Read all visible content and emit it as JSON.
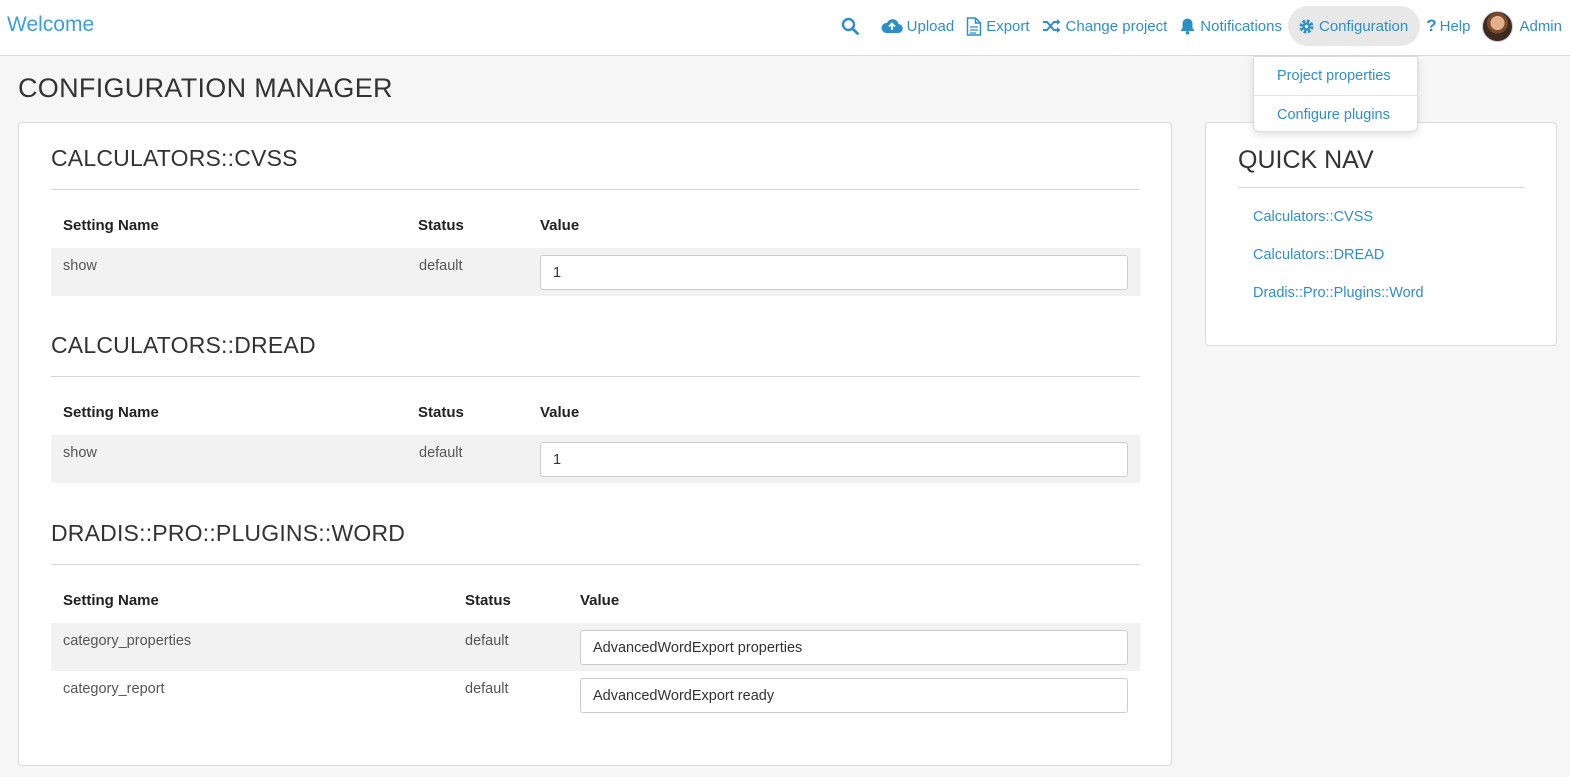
{
  "brand": "Welcome",
  "nav": {
    "upload": "Upload",
    "export": "Export",
    "change_project": "Change project",
    "notifications": "Notifications",
    "configuration": "Configuration",
    "help": "Help",
    "user": "Admin"
  },
  "dropdown": {
    "items": [
      "Project properties",
      "Configure plugins"
    ]
  },
  "page_title": "CONFIGURATION MANAGER",
  "sections": [
    {
      "title": "CALCULATORS::CVSS",
      "headers": [
        "Setting Name",
        "Status",
        "Value"
      ],
      "rows": [
        {
          "name": "show",
          "status": "default",
          "value": "1"
        }
      ]
    },
    {
      "title": "CALCULATORS::DREAD",
      "headers": [
        "Setting Name",
        "Status",
        "Value"
      ],
      "rows": [
        {
          "name": "show",
          "status": "default",
          "value": "1"
        }
      ]
    },
    {
      "title": "DRADIS::PRO::PLUGINS::WORD",
      "headers": [
        "Setting Name",
        "Status",
        "Value"
      ],
      "rows": [
        {
          "name": "category_properties",
          "status": "default",
          "value": "AdvancedWordExport properties"
        },
        {
          "name": "category_report",
          "status": "default",
          "value": "AdvancedWordExport ready"
        }
      ]
    }
  ],
  "quick_nav": {
    "title": "QUICK NAV",
    "links": [
      "Calculators::CVSS",
      "Calculators::DREAD",
      "Dradis::Pro::Plugins::Word"
    ]
  },
  "colors": {
    "link": "#2e8fc7",
    "brand": "#3aa0d5",
    "background": "#f6f6f6"
  }
}
